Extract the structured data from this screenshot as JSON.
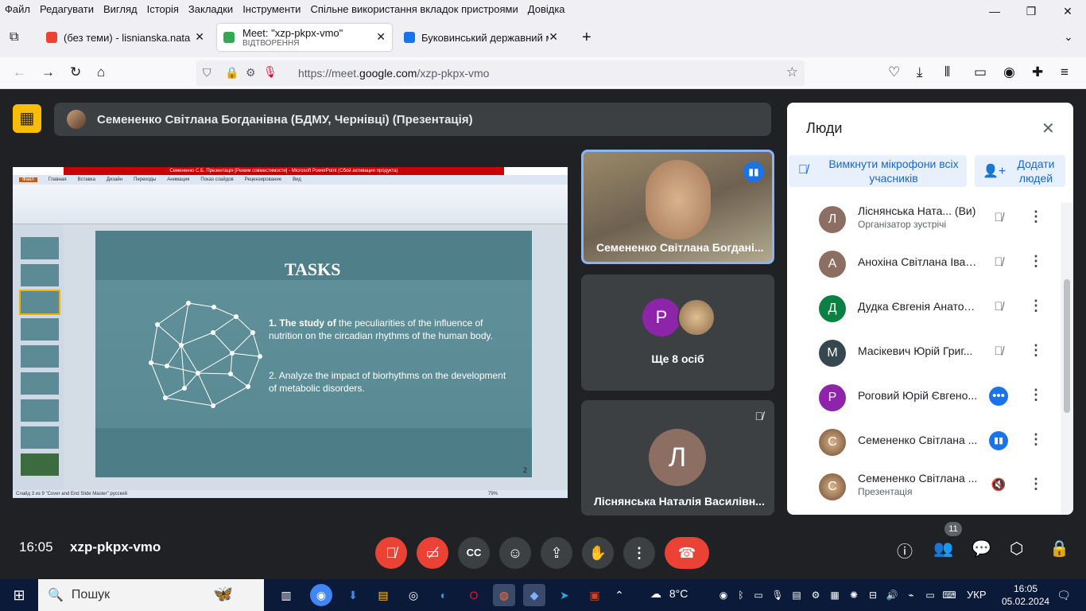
{
  "firefox": {
    "menu": [
      "Файл",
      "Редагувати",
      "Вигляд",
      "Історія",
      "Закладки",
      "Інструменти",
      "Спільне використання вкладок пристроями",
      "Довідка"
    ],
    "tabs": [
      {
        "title": "(без теми) - lisnianska.nata@bsmu.edu.ua",
        "color": "#ea4335"
      },
      {
        "title": "Meet: \"xzp-pkpx-vmo\"",
        "sub": "ВІДТВОРЕННЯ",
        "color": "#34a853"
      },
      {
        "title": "Буковинський державний медичний",
        "color": "#1a73e8"
      }
    ],
    "url_prefix": "https://meet.",
    "url_domain": "google.com",
    "url_path": "/xzp-pkpx-vmo"
  },
  "meet": {
    "presenter_bar": "Семененко Світлана Богданівна (БДМУ, Чернівці) (Презентація)",
    "tiles": [
      {
        "name": "Семененко Світлана Богдані..."
      },
      {
        "name": "Ще 8 осіб",
        "avatar": "P"
      },
      {
        "name": "Ліснянська Наталія Василівн...",
        "avatar": "Л"
      }
    ],
    "slide": {
      "ppt_title": "Семененко С.Б. Презентація [Режим совместимости] - Microsoft PowerPoint (Сбой активации продукта)",
      "ribbon_tabs": [
        "Файл",
        "Главная",
        "Вставка",
        "Дизайн",
        "Переходы",
        "Анимация",
        "Показ слайдов",
        "Рецензирование",
        "Вид"
      ],
      "title": "TASKS",
      "item1_bold": "The study of",
      "item1_rest": "the peculiarities of the influence of nutrition on the circadian rhythms of the human body.",
      "item2": "Analyze the impact of biorhythms on the development of metabolic disorders.",
      "num1": "1.",
      "num2": "2.",
      "page": "2",
      "status": "Слайд 3 из 9   \"Cover and End Slide Master\"   русский",
      "zoom": "79%"
    },
    "people": {
      "title": "Люди",
      "mute_all": "Вимкнути мікрофони всіх учасників",
      "add": "Додати людей",
      "rows": [
        {
          "name": "Ліснянська Ната... (Ви)",
          "sub": "Організатор зустрічі",
          "avatar": "Л",
          "color": "#8d6e63"
        },
        {
          "name": "Анохіна Світлана Іван...",
          "avatar": "А",
          "color": "#8d6e63"
        },
        {
          "name": "Дудка Євгенія Анатол...",
          "avatar": "Д",
          "color": "#0b8043"
        },
        {
          "name": "Масікевич Юрій Григ...",
          "avatar": "М",
          "color": "#37474f"
        },
        {
          "name": "Роговий Юрій Євгено...",
          "avatar": "Р",
          "color": "#8e24aa"
        },
        {
          "name": "Семененко Світлана ...",
          "avatar": "С",
          "color": "#795548"
        },
        {
          "name": "Семененко Світлана ...",
          "sub": "Презентація",
          "avatar": "С",
          "color": "#795548"
        }
      ]
    },
    "time": "16:05",
    "meeting_code": "xzp-pkpx-vmo",
    "participants_badge": "11"
  },
  "taskbar": {
    "search": "Пошук",
    "weather": "8°C",
    "lang": "УКР",
    "time": "16:05",
    "date": "05.02.2024"
  }
}
